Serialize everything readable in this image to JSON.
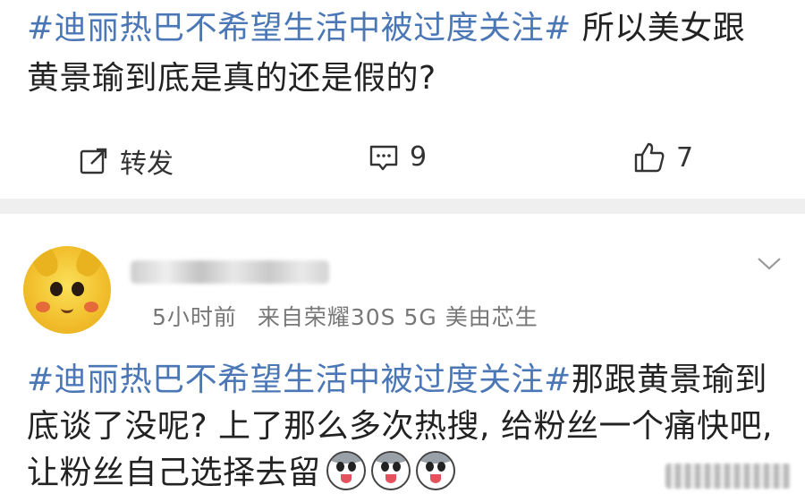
{
  "post": {
    "topic": "#迪丽热巴不希望生活中被过度关注#",
    "text": " 所以美女跟黄景瑜到底是真的还是假的?",
    "actions": {
      "repost_label": "转发",
      "comment_count": "9",
      "like_count": "7"
    }
  },
  "comment": {
    "time": "5小时前",
    "source": "来自荣耀30S 5G 美由芯生",
    "topic": "#迪丽热巴不希望生活中被过度关注#",
    "text": "那跟黄景瑜到底谈了没呢? 上了那么多次热搜, 给粉丝一个痛快吧, 让粉丝自己选择去留",
    "emoji_icon": "husky-dog-emoji-icon"
  },
  "colors": {
    "topic_link": "#4b77b6",
    "meta_text": "#777777",
    "separator": "#efefef"
  }
}
